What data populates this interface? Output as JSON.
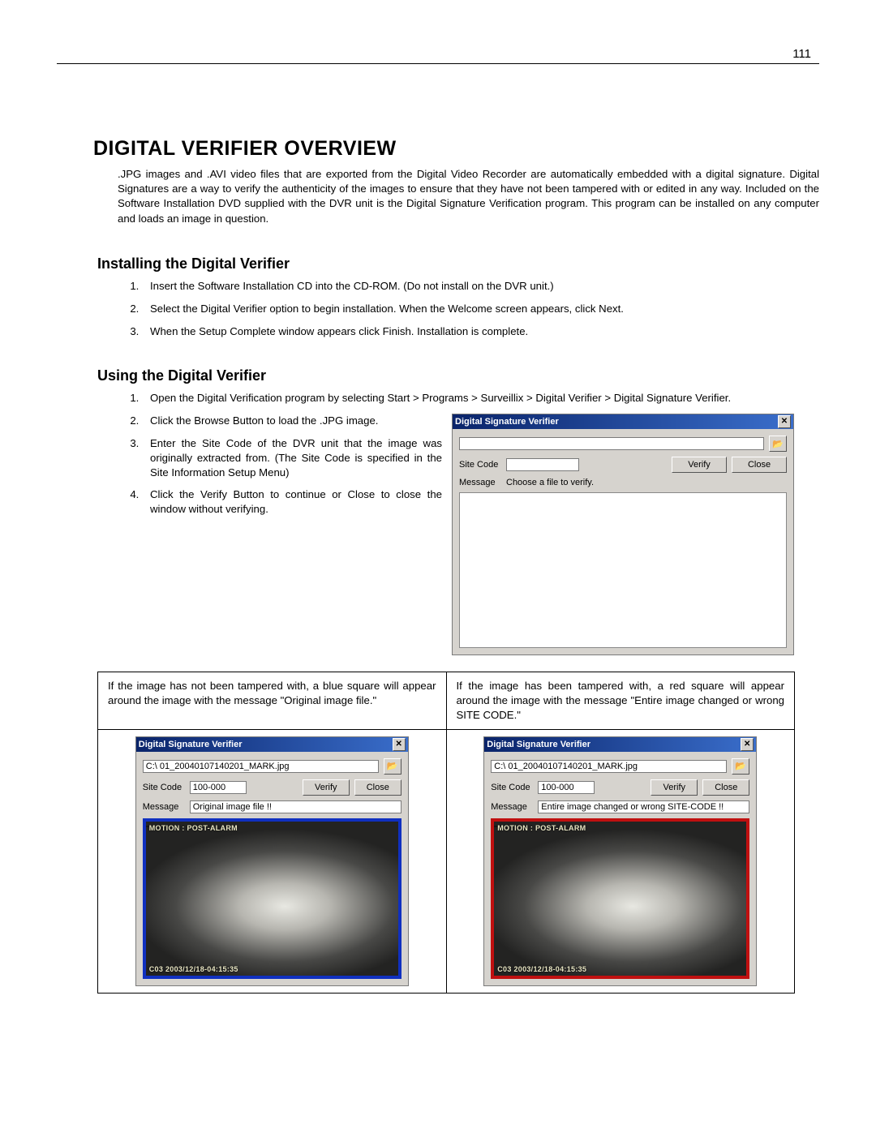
{
  "page_number": "111",
  "h1": "DIGITAL VERIFIER OVERVIEW",
  "intro": ".JPG images and .AVI video files that are exported from the Digital Video Recorder are automatically embedded with a digital signature.  Digital Signatures are a way to verify the authenticity of the images to ensure that they have not been tampered with or edited in any way.  Included on the Software Installation DVD supplied with the DVR unit is the Digital Signature Verification program.  This program can be installed on any computer and loads an image in question.",
  "installing": {
    "heading": "Installing the Digital Verifier",
    "steps": [
      "Insert the Software Installation CD into the CD-ROM.  (Do not install on the DVR unit.)",
      "Select the Digital Verifier option to begin installation.  When the Welcome screen appears, click Next.",
      "When the Setup Complete window appears click Finish.  Installation is complete."
    ]
  },
  "using": {
    "heading": "Using the Digital Verifier",
    "steps": [
      "Open the Digital Verification program by selecting Start > Programs > Surveillix > Digital Verifier > Digital Signature Verifier.",
      "Click the Browse Button to load the .JPG image.",
      "Enter the Site Code of the DVR unit that the image was originally extracted from.  (The Site Code is specified in the Site Information Setup Menu)",
      "Click the Verify Button to continue or Close to close the window without verifying."
    ]
  },
  "dialog": {
    "title": "Digital Signature Verifier",
    "close_x": "✕",
    "browse_icon": "📂",
    "path_value": "",
    "site_code_label": "Site Code",
    "site_code_value": "",
    "verify_btn": "Verify",
    "close_btn": "Close",
    "message_label": "Message",
    "message_value": "Choose a file to verify."
  },
  "compare": {
    "left_desc": "If the image has not been tampered with, a blue square will appear around the image with the message \"Original image file.\"",
    "right_desc": "If the image has been tampered with, a red square will appear around the image with the message \"Entire image changed or wrong SITE CODE.\"",
    "left_dlg": {
      "title": "Digital Signature Verifier",
      "path": "C:\\ 01_20040107140201_MARK.jpg",
      "site_code": "100-000",
      "message": "Original image file !!",
      "overlay_top": "MOTION : POST-ALARM",
      "overlay_bot": "C03 2003/12/18-04:15:35"
    },
    "right_dlg": {
      "title": "Digital Signature Verifier",
      "path": "C:\\ 01_20040107140201_MARK.jpg",
      "site_code": "100-000",
      "message": "Entire image changed or wrong SITE-CODE !!",
      "overlay_top": "MOTION : POST-ALARM",
      "overlay_bot": "C03 2003/12/18-04:15:35"
    },
    "verify_btn": "Verify",
    "close_btn": "Close",
    "site_code_label": "Site Code",
    "message_label": "Message",
    "close_x": "✕",
    "browse_icon": "📂"
  }
}
